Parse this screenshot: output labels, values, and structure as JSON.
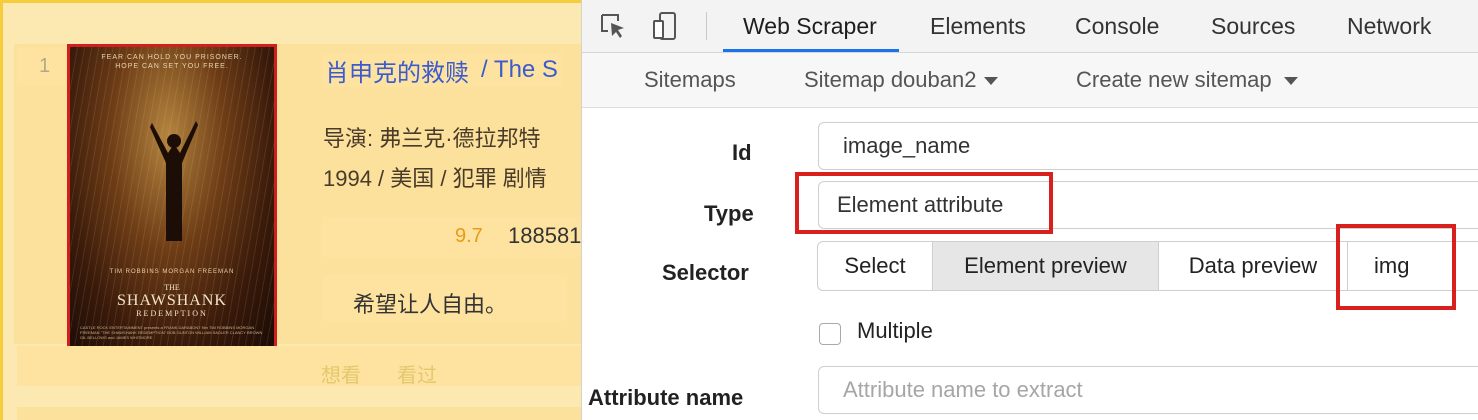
{
  "page": {
    "rank": "1",
    "title_cn": "肖申克的救赎",
    "title_sep": "/ The S",
    "director_line": "导演: 弗兰克·德拉邦特",
    "meta_line": "1994 / 美国 / 犯罪 剧情",
    "rating": "9.7",
    "votes": "188581",
    "quote": "希望让人自由。",
    "want": "想看",
    "seen": "看过",
    "poster": {
      "tagline1": "FEAR CAN HOLD YOU PRISONER.",
      "tagline2": "HOPE CAN SET YOU FREE.",
      "actors": "TIM ROBBINS     MORGAN FREEMAN",
      "title_the": "THE",
      "title_main": "SHAWSHANK",
      "title_sub": "REDEMPTION",
      "credits": "CASTLE ROCK ENTERTAINMENT presents a FRANK DARABONT film TIM ROBBINS MORGAN FREEMAN \"THE SHAWSHANK REDEMPTION\" BOB GUNTON WILLIAM SADLER CLANCY BROWN GIL BELLOWS and JAMES WHITMORE"
    }
  },
  "devtools": {
    "tabs": [
      "Web Scraper",
      "Elements",
      "Console",
      "Sources",
      "Network"
    ],
    "active_tab": "Web Scraper",
    "subnav": {
      "sitemaps": "Sitemaps",
      "sitemap": "Sitemap douban2",
      "create": "Create new sitemap"
    },
    "form": {
      "id_label": "Id",
      "id_value": "image_name",
      "type_label": "Type",
      "type_value": "Element attribute",
      "selector_label": "Selector",
      "selector_buttons": [
        "Select",
        "Element preview",
        "Data preview"
      ],
      "selector_value": "img",
      "multiple_label": "Multiple",
      "multiple_checked": false,
      "attr_label": "Attribute name",
      "attr_placeholder": "Attribute name to extract"
    }
  },
  "colors": {
    "highlight": "#fbe19c",
    "link_blue": "#3b5bcf",
    "rating_orange": "#e89b18",
    "annotation_red": "#d8201f",
    "tab_underline": "#1a73e8"
  }
}
